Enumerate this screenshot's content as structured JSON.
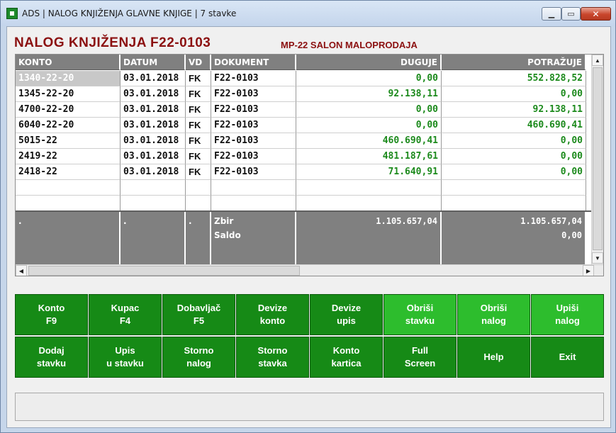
{
  "window": {
    "title": "ADS | NALOG KNJIŽENJA GLAVNE KNJIGE | 7 stavke",
    "min_glyph": "▁",
    "max_glyph": "▭",
    "close_glyph": "✕"
  },
  "document": {
    "title": "NALOG KNJIŽENJA F22-0103",
    "subtitle": "MP-22 SALON MALOPRODAJA"
  },
  "table": {
    "headers": [
      "KONTO",
      "DATUM",
      "VD",
      "DOKUMENT",
      "DUGUJE",
      "POTRAŽUJE"
    ],
    "rows": [
      [
        "1340-22-20",
        "03.01.2018",
        "FK",
        "F22-0103",
        "0,00",
        "552.828,52"
      ],
      [
        "1345-22-20",
        "03.01.2018",
        "FK",
        "F22-0103",
        "92.138,11",
        "0,00"
      ],
      [
        "4700-22-20",
        "03.01.2018",
        "FK",
        "F22-0103",
        "0,00",
        "92.138,11"
      ],
      [
        "6040-22-20",
        "03.01.2018",
        "FK",
        "F22-0103",
        "0,00",
        "460.690,41"
      ],
      [
        "5015-22",
        "03.01.2018",
        "FK",
        "F22-0103",
        "460.690,41",
        "0,00"
      ],
      [
        "2419-22",
        "03.01.2018",
        "FK",
        "F22-0103",
        "481.187,61",
        "0,00"
      ],
      [
        "2418-22",
        "03.01.2018",
        "FK",
        "F22-0103",
        "71.640,91",
        "0,00"
      ]
    ],
    "selected_row": 0,
    "totals": {
      "konto": ".",
      "datum": ".",
      "vd": ".",
      "zbir_label": "Zbir",
      "saldo_label": "Saldo",
      "zbir_duguje": "1.105.657,04",
      "zbir_potrazuje": "1.105.657,04",
      "saldo_value": "0,00"
    },
    "scroll_up": "▲",
    "scroll_down": "▼",
    "scroll_left": "◀",
    "scroll_right": "▶"
  },
  "buttons": {
    "row1": [
      {
        "line1": "Konto",
        "line2": "F9",
        "style": "dark"
      },
      {
        "line1": "Kupac",
        "line2": "F4",
        "style": "dark"
      },
      {
        "line1": "Dobavljač",
        "line2": "F5",
        "style": "dark"
      },
      {
        "line1": "Devize",
        "line2": "konto",
        "style": "dark"
      },
      {
        "line1": "Devize",
        "line2": "upis",
        "style": "dark"
      },
      {
        "line1": "Obriši",
        "line2": "stavku",
        "style": "light"
      },
      {
        "line1": "Obriši",
        "line2": "nalog",
        "style": "light"
      },
      {
        "line1": "Upiši",
        "line2": "nalog",
        "style": "light"
      }
    ],
    "row2": [
      {
        "line1": "Dodaj",
        "line2": "stavku",
        "style": "dark"
      },
      {
        "line1": "Upis",
        "line2": "u stavku",
        "style": "dark"
      },
      {
        "line1": "Storno",
        "line2": "nalog",
        "style": "dark"
      },
      {
        "line1": "Storno",
        "line2": "stavka",
        "style": "dark"
      },
      {
        "line1": "Konto",
        "line2": "kartica",
        "style": "dark"
      },
      {
        "line1": "Full",
        "line2": "Screen",
        "style": "dark"
      },
      {
        "line1": "Help",
        "line2": "",
        "style": "dark"
      },
      {
        "line1": "Exit",
        "line2": "",
        "style": "dark"
      }
    ]
  },
  "colors": {
    "title_red": "#8b1010",
    "button_dark": "#168a16",
    "button_light": "#2dbd2d",
    "amount_green": "#1c8a1c",
    "header_gray": "#808080"
  }
}
